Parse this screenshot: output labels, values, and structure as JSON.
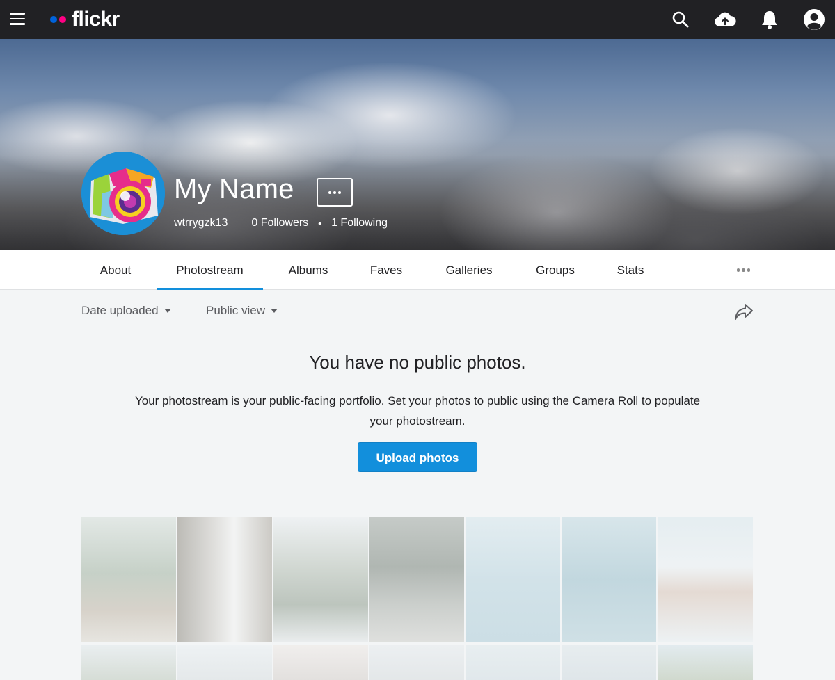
{
  "topbar": {
    "logo_text": "flickr",
    "logo_colors": {
      "blue": "#0063dc",
      "pink": "#ff0084"
    },
    "icons": [
      "search-icon",
      "upload-cloud-icon",
      "notifications-bell-icon",
      "account-avatar-icon"
    ]
  },
  "profile": {
    "name": "My Name",
    "username": "wtrrygzk13",
    "followers": "0 Followers",
    "separator": "•",
    "following": "1 Following"
  },
  "tabs": [
    {
      "label": "About",
      "active": false
    },
    {
      "label": "Photostream",
      "active": true
    },
    {
      "label": "Albums",
      "active": false
    },
    {
      "label": "Faves",
      "active": false
    },
    {
      "label": "Galleries",
      "active": false
    },
    {
      "label": "Groups",
      "active": false
    },
    {
      "label": "Stats",
      "active": false
    }
  ],
  "filters": {
    "sort": "Date uploaded",
    "view": "Public view"
  },
  "empty_state": {
    "title": "You have no public photos.",
    "description": "Your photostream is your public-facing portfolio. Set your photos to public using the Camera Roll to populate your photostream.",
    "button": "Upload photos"
  },
  "colors": {
    "accent": "#128fdc",
    "topbar": "#212124",
    "page_bg": "#f3f5f6"
  }
}
